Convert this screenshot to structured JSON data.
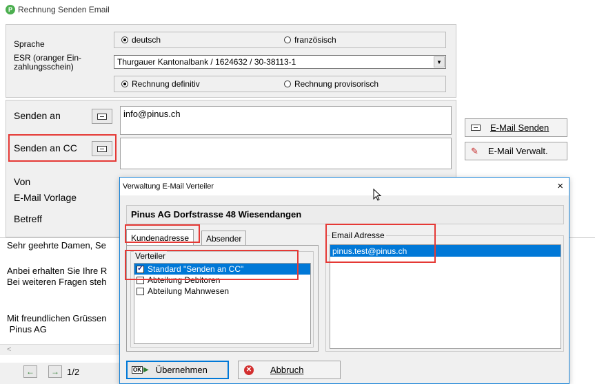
{
  "window": {
    "title": "Rechnung Senden Email",
    "logo_text": "P"
  },
  "form": {
    "sprache_label": "Sprache",
    "lang_options": [
      "deutsch",
      "französisch"
    ],
    "esr_label_line1": "ESR (oranger Ein-",
    "esr_label_line2": "zahlungsschein)",
    "esr_value": "Thurgauer Kantonalbank / 1624632 / 30-38113-1",
    "type_options": [
      "Rechnung definitiv",
      "Rechnung provisorisch"
    ],
    "senden_an_label": "Senden an",
    "senden_an_value": "info@pinus.ch",
    "senden_an_cc_label": "Senden an CC",
    "senden_an_cc_value": "",
    "von_label": "Von",
    "vorlage_label": "E-Mail Vorlage",
    "betreff_label": "Betreff"
  },
  "buttons": {
    "email_senden": "E-Mail Senden",
    "email_verwalt": "E-Mail Verwalt."
  },
  "body_text": {
    "line1": "Sehr geehrte Damen, Se",
    "line2": "Anbei erhalten Sie Ihre R",
    "line3": "Bei weiteren Fragen steh",
    "line4": "Mit freundlichen Grüssen",
    "line5": " Pinus AG"
  },
  "pager": {
    "prev": "←",
    "next": "→",
    "page": "1/2",
    "scroll_left": "<"
  },
  "dialog": {
    "title": "Verwaltung E-Mail Verteiler",
    "close": "×",
    "company": "Pinus AG Dorfstrasse 48 Wiesendangen",
    "tabs": [
      "Kundenadresse",
      "Absender"
    ],
    "verteiler_label": "Verteiler",
    "verteiler_items": [
      {
        "label": "Standard \"Senden an CC\"",
        "checked": true
      },
      {
        "label": "Abteilung Debitoren",
        "checked": false
      },
      {
        "label": "Abteilung Mahnwesen",
        "checked": false
      }
    ],
    "email_group_label": "Email Adresse",
    "emails": [
      "pinus.test@pinus.ch"
    ],
    "ok_button": "Übernehmen",
    "ok_icon_text": "OK",
    "cancel_button": "Abbruch"
  },
  "colors": {
    "selection": "#0078d7",
    "highlight": "#e53935",
    "dialog_border": "#1883d7"
  }
}
